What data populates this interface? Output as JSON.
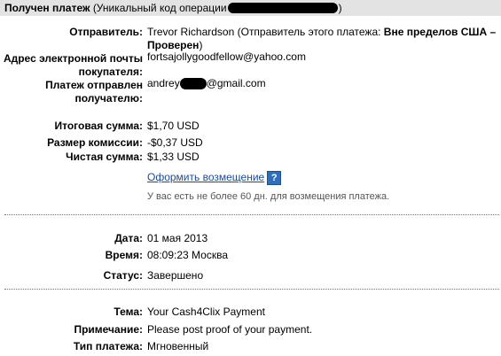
{
  "header": {
    "title": "Получен платеж",
    "code_prefix": "(Уникальный код операции",
    "code_suffix": ")"
  },
  "sender": {
    "label": "Отправитель:",
    "name": "Trevor Richardson",
    "note": "(Отправитель этого платежа:",
    "status": "Вне пределов США – Проверен",
    "note_end": ")"
  },
  "sender_email": {
    "label_line1": "Адрес электронной почты",
    "label_line2": "покупателя:",
    "value": "fortsajollygoodfellow@yahoo.com"
  },
  "recipient": {
    "label_line1": "Платеж отправлен",
    "label_line2": "получателю:",
    "prefix": "andrey",
    "suffix": "@gmail.com"
  },
  "amounts": {
    "total_label": "Итоговая сумма:",
    "total_value": "$1,70 USD",
    "fee_label": "Размер комиссии:",
    "fee_value": "-$0,37 USD",
    "net_label": "Чистая сумма:",
    "net_value": "$1,33 USD"
  },
  "refund": {
    "link_text": "Оформить возмещение",
    "help_icon": "?",
    "note": "У вас есть не более 60 дн. для возмещения платежа."
  },
  "details": {
    "date_label": "Дата:",
    "date_value": "01 мая 2013",
    "time_label": "Время:",
    "time_value": "08:09:23 Москва",
    "status_label": "Статус:",
    "status_value": "Завершено"
  },
  "message": {
    "subject_label": "Тема:",
    "subject_value": "Your Cash4Clix Payment",
    "note_label": "Примечание:",
    "note_value": "Please post proof of your payment.",
    "type_label": "Тип платежа:",
    "type_value": "Мгновенный"
  }
}
